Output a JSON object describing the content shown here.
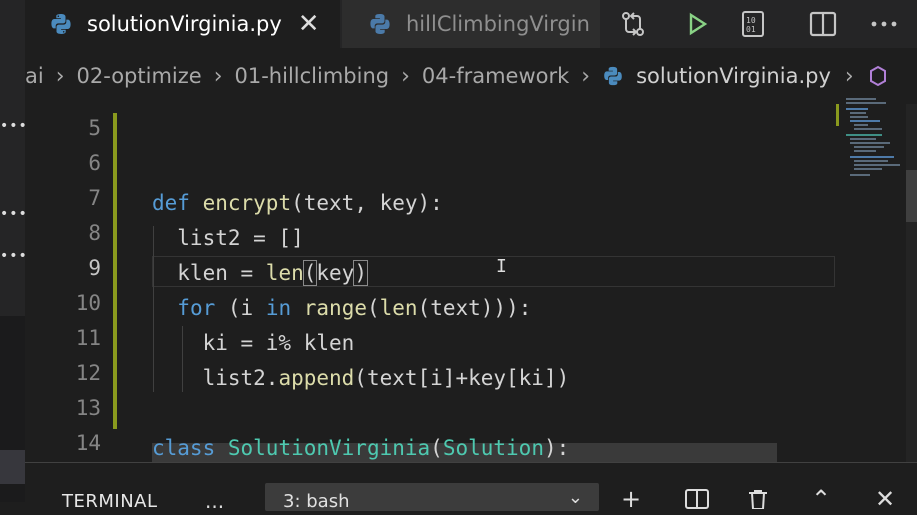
{
  "tabs": [
    {
      "label": "solutionVirginia.py",
      "active": true
    },
    {
      "label": "hillClimbingVirgin",
      "active": false
    }
  ],
  "toolbar_icons": [
    "git-compare-icon",
    "run-icon",
    "binary-file-icon",
    "split-editor-icon",
    "more-actions-icon"
  ],
  "breadcrumb": [
    "ai",
    "02-optimize",
    "01-hillclimbing",
    "04-framework",
    "solutionVirginia.py"
  ],
  "code": {
    "line_numbers": [
      "5",
      "6",
      "7",
      "8",
      "9",
      "10",
      "11",
      "12",
      "13",
      "14"
    ],
    "current_line": "9"
  },
  "panel": {
    "terminal_label": "TERMINAL",
    "more_label": "...",
    "shell_selected": "3: bash"
  },
  "colors": {
    "keyword": "#569cd6",
    "function": "#dcdcaa",
    "class": "#4ec9b0",
    "modified_gutter": "#8a9a1e"
  }
}
